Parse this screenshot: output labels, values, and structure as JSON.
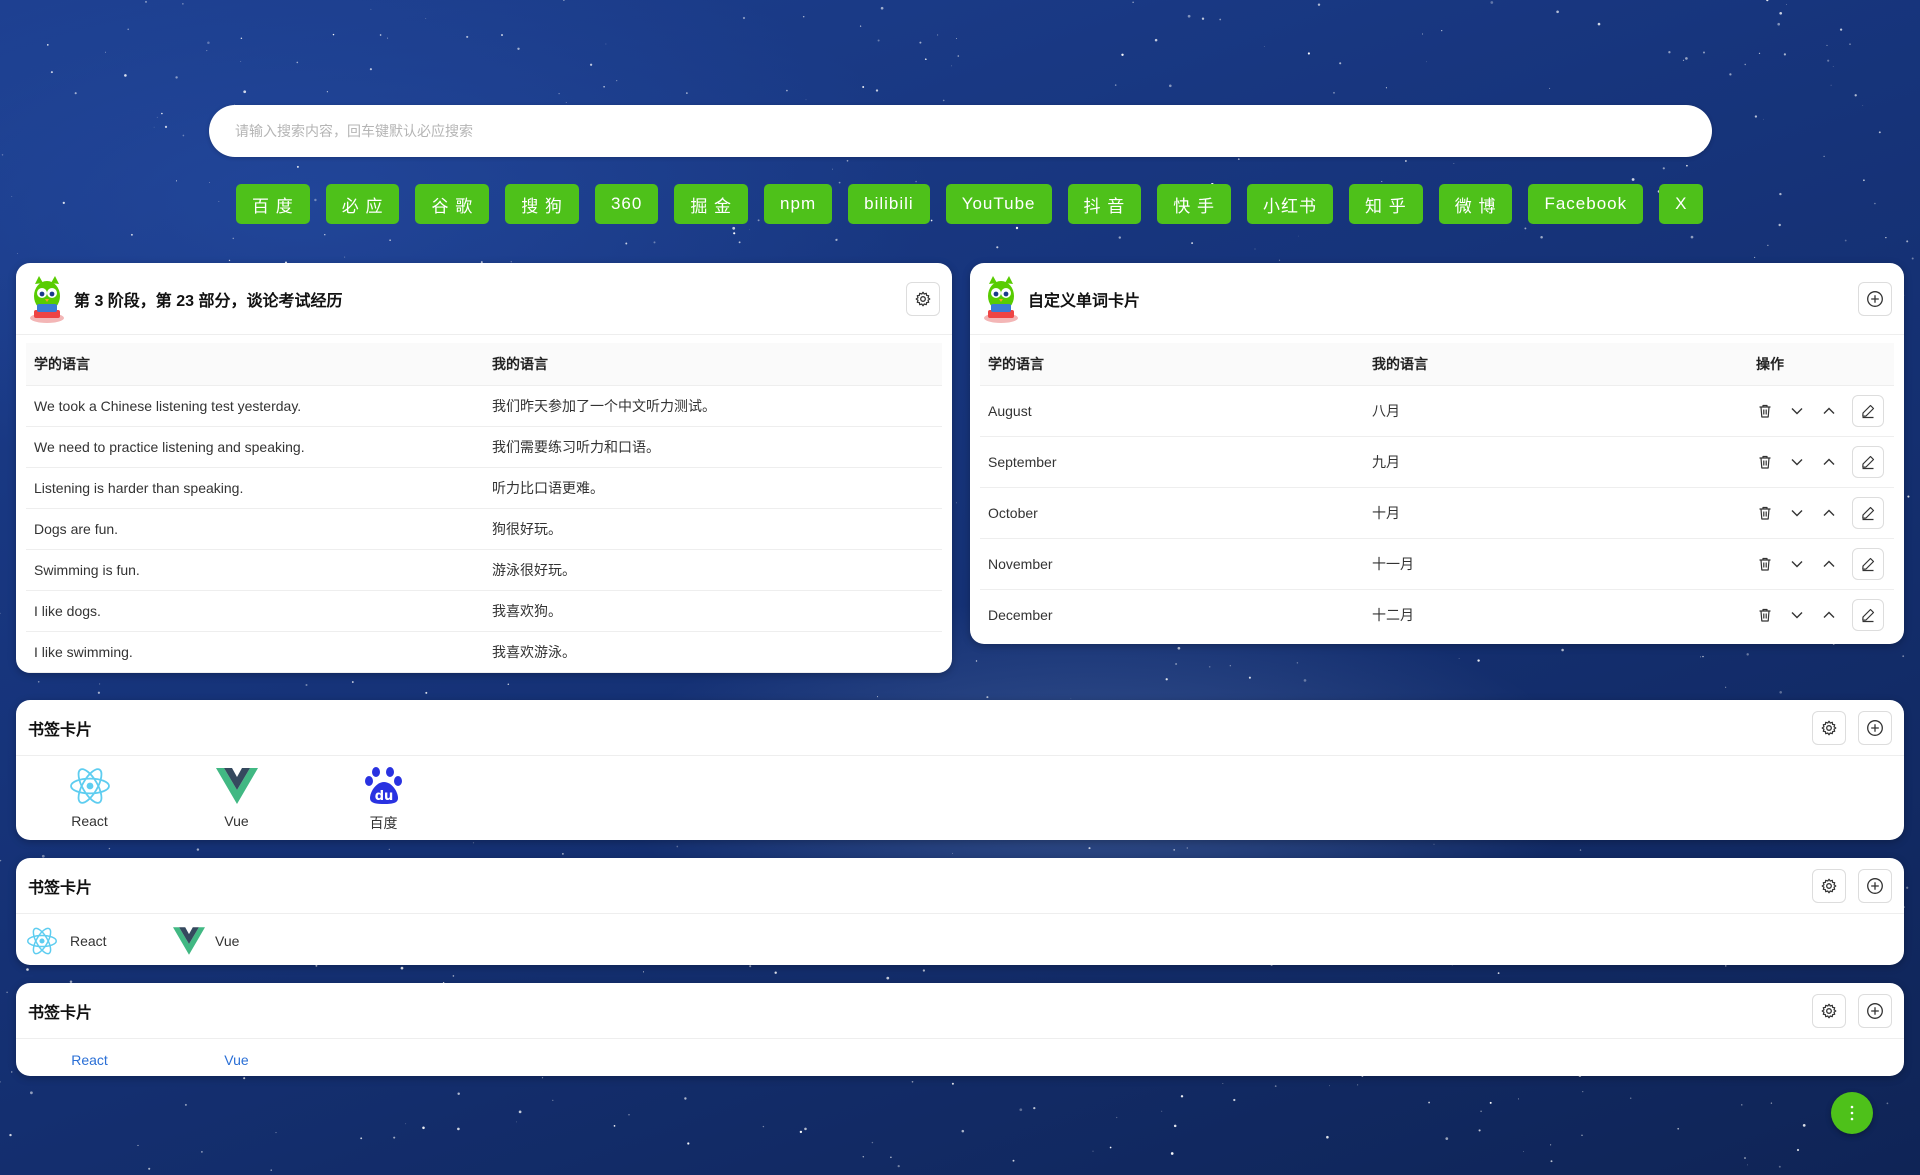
{
  "search": {
    "placeholder": "请输入搜索内容，回车键默认必应搜索"
  },
  "engines": [
    "百 度",
    "必 应",
    "谷 歌",
    "搜 狗",
    "360",
    "掘 金",
    "npm",
    "bilibili",
    "YouTube",
    "抖 音",
    "快 手",
    "小红书",
    "知 乎",
    "微 博",
    "Facebook",
    "X"
  ],
  "lesson_card": {
    "title": "第 3 阶段，第 23 部分，谈论考试经历",
    "col_learn": "学的语言",
    "col_mine": "我的语言",
    "rows": [
      {
        "learn": "We took a Chinese listening test yesterday.",
        "mine": "我们昨天参加了一个中文听力测试。"
      },
      {
        "learn": "We need to practice listening and speaking.",
        "mine": "我们需要练习听力和口语。"
      },
      {
        "learn": "Listening is harder than speaking.",
        "mine": "听力比口语更难。"
      },
      {
        "learn": "Dogs are fun.",
        "mine": "狗很好玩。"
      },
      {
        "learn": "Swimming is fun.",
        "mine": "游泳很好玩。"
      },
      {
        "learn": "I like dogs.",
        "mine": "我喜欢狗。"
      },
      {
        "learn": "I like swimming.",
        "mine": "我喜欢游泳。"
      }
    ]
  },
  "word_card": {
    "title": "自定义单词卡片",
    "col_learn": "学的语言",
    "col_mine": "我的语言",
    "col_ops": "操作",
    "rows": [
      {
        "learn": "August",
        "mine": "八月"
      },
      {
        "learn": "September",
        "mine": "九月"
      },
      {
        "learn": "October",
        "mine": "十月"
      },
      {
        "learn": "November",
        "mine": "十一月"
      },
      {
        "learn": "December",
        "mine": "十二月"
      }
    ]
  },
  "bookmark_cards": [
    {
      "title": "书签卡片",
      "items": [
        "React",
        "Vue",
        "百度"
      ]
    },
    {
      "title": "书签卡片",
      "items": [
        "React",
        "Vue"
      ]
    },
    {
      "title": "书签卡片",
      "items": [
        "React",
        "Vue"
      ]
    }
  ],
  "colors": {
    "accent": "#4ec11a",
    "link": "#2a6fd6"
  }
}
